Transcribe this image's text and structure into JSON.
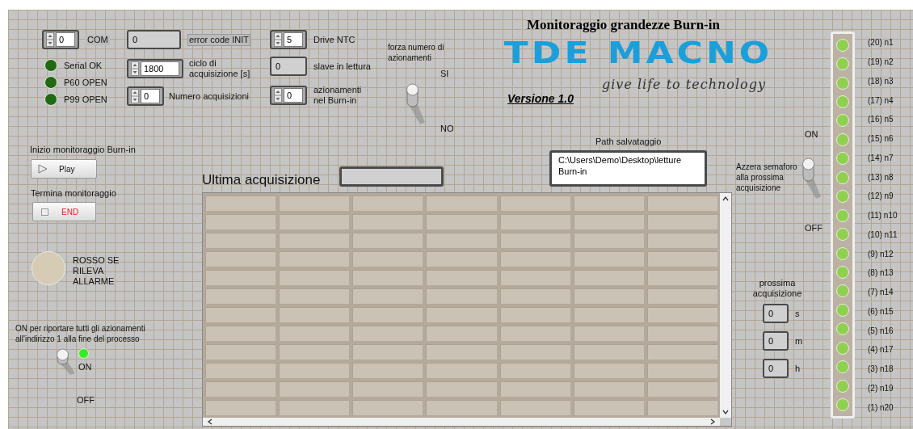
{
  "title": "Monitoraggio grandezze Burn-in",
  "logo": {
    "wordmark": "TDE MACNO",
    "tagline": "give life to technology"
  },
  "version": "Versione 1.0",
  "com": {
    "value": "0",
    "label": "COM"
  },
  "status_leds": [
    {
      "label": "Serial OK",
      "on": false
    },
    {
      "label": "P60 OPEN",
      "on": false
    },
    {
      "label": "P99 OPEN",
      "on": false
    }
  ],
  "error_code": {
    "value": "0",
    "label": "error code INIT"
  },
  "ciclo": {
    "value": "1800",
    "label": "ciclo di acquisizione [s]"
  },
  "numero_acquisizioni": {
    "value": "0",
    "label": "Numero acquisizioni"
  },
  "drive_ntc": {
    "value": "5",
    "label": "Drive NTC"
  },
  "slave": {
    "value": "0",
    "label": "slave in lettura"
  },
  "azionamenti": {
    "value": "0",
    "label": "azionamenti nel Burn-in"
  },
  "forza_switch": {
    "label": "forza numero di azionamenti",
    "on_label": "SI",
    "off_label": "NO",
    "on": true
  },
  "start": {
    "caption": "Inizio monitoraggio Burn-in",
    "label": "Play"
  },
  "stop": {
    "caption": "Termina monitoraggio",
    "label": "END",
    "checked": false
  },
  "alarm": {
    "label": "ROSSO SE RILEVA ALLARME",
    "on": false
  },
  "reset_option": {
    "caption": "ON per riportare tutti gli azionamenti all'indirizzo 1 alla fine del processo",
    "on_label": "ON",
    "off_label": "OFF",
    "on": true,
    "led_on": true
  },
  "ultima": {
    "label": "Ultima acquisizione"
  },
  "path": {
    "label": "Path salvataggio",
    "value": "C:\\Users\\Demo\\Desktop\\letture Burn-in"
  },
  "azzera": {
    "label": "Azzera semaforo alla prossima acquisizione",
    "on_label": "ON",
    "off_label": "OFF",
    "on": true
  },
  "prossima": {
    "label": "prossima acquisizione",
    "fields": [
      {
        "value": "0",
        "unit": "s"
      },
      {
        "value": "0",
        "unit": "m"
      },
      {
        "value": "0",
        "unit": "h"
      }
    ]
  },
  "nodes": [
    {
      "label": "(20) n1",
      "on": true
    },
    {
      "label": "(19) n2",
      "on": true
    },
    {
      "label": "(18) n3",
      "on": true
    },
    {
      "label": "(17) n4",
      "on": true
    },
    {
      "label": "(16) n5",
      "on": true
    },
    {
      "label": "(15) n6",
      "on": true
    },
    {
      "label": "(14) n7",
      "on": true
    },
    {
      "label": "(13) n8",
      "on": true
    },
    {
      "label": "(12) n9",
      "on": true
    },
    {
      "label": "(11) n10",
      "on": true
    },
    {
      "label": "(10) n11",
      "on": true
    },
    {
      "label": "(9) n12",
      "on": true
    },
    {
      "label": "(8) n13",
      "on": true
    },
    {
      "label": "(7) n14",
      "on": true
    },
    {
      "label": "(6) n15",
      "on": true
    },
    {
      "label": "(5) n16",
      "on": true
    },
    {
      "label": "(4) n17",
      "on": true
    },
    {
      "label": "(3) n18",
      "on": true
    },
    {
      "label": "(2) n19",
      "on": true
    },
    {
      "label": "(1) n20",
      "on": true
    }
  ]
}
